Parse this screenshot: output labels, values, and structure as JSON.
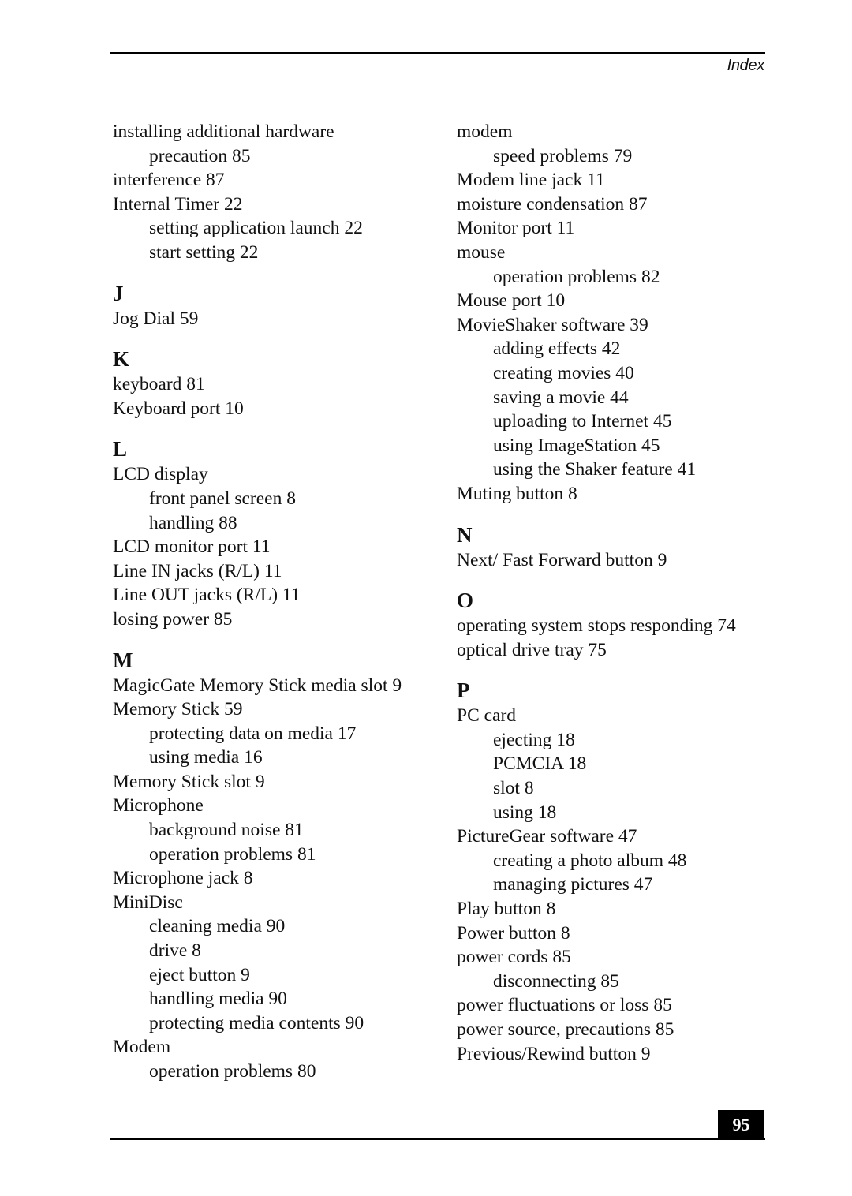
{
  "header": {
    "running_head": "Index"
  },
  "footer": {
    "page_number": "95"
  },
  "columns": [
    {
      "blocks": [
        {
          "type": "entry",
          "text": "installing additional hardware",
          "level": 0
        },
        {
          "type": "entry",
          "text": "precaution 85",
          "level": 1
        },
        {
          "type": "entry",
          "text": "interference 87",
          "level": 0
        },
        {
          "type": "entry",
          "text": "Internal Timer 22",
          "level": 0
        },
        {
          "type": "entry",
          "text": "setting application launch 22",
          "level": 1
        },
        {
          "type": "entry",
          "text": "start setting 22",
          "level": 1
        },
        {
          "type": "letter",
          "text": "J"
        },
        {
          "type": "entry",
          "text": "Jog Dial 59",
          "level": 0
        },
        {
          "type": "letter",
          "text": "K"
        },
        {
          "type": "entry",
          "text": "keyboard 81",
          "level": 0
        },
        {
          "type": "entry",
          "text": "Keyboard port 10",
          "level": 0
        },
        {
          "type": "letter",
          "text": "L"
        },
        {
          "type": "entry",
          "text": "LCD display",
          "level": 0
        },
        {
          "type": "entry",
          "text": "front panel screen 8",
          "level": 1
        },
        {
          "type": "entry",
          "text": "handling 88",
          "level": 1
        },
        {
          "type": "entry",
          "text": "LCD monitor port 11",
          "level": 0
        },
        {
          "type": "entry",
          "text": "Line IN jacks (R/L) 11",
          "level": 0
        },
        {
          "type": "entry",
          "text": "Line OUT jacks (R/L) 11",
          "level": 0
        },
        {
          "type": "entry",
          "text": "losing power 85",
          "level": 0
        },
        {
          "type": "letter",
          "text": "M"
        },
        {
          "type": "entry",
          "text": "MagicGate Memory Stick media slot 9",
          "level": 0
        },
        {
          "type": "entry",
          "text": "Memory Stick 59",
          "level": 0
        },
        {
          "type": "entry",
          "text": "protecting data on media 17",
          "level": 1
        },
        {
          "type": "entry",
          "text": "using media 16",
          "level": 1
        },
        {
          "type": "entry",
          "text": "Memory Stick slot 9",
          "level": 0
        },
        {
          "type": "entry",
          "text": "Microphone",
          "level": 0
        },
        {
          "type": "entry",
          "text": "background noise 81",
          "level": 1
        },
        {
          "type": "entry",
          "text": "operation problems 81",
          "level": 1
        },
        {
          "type": "entry",
          "text": "Microphone jack 8",
          "level": 0
        },
        {
          "type": "entry",
          "text": "MiniDisc",
          "level": 0
        },
        {
          "type": "entry",
          "text": "cleaning media 90",
          "level": 1
        },
        {
          "type": "entry",
          "text": "drive 8",
          "level": 1
        },
        {
          "type": "entry",
          "text": "eject button 9",
          "level": 1
        },
        {
          "type": "entry",
          "text": "handling media 90",
          "level": 1
        },
        {
          "type": "entry",
          "text": "protecting media contents 90",
          "level": 1
        },
        {
          "type": "entry",
          "text": "Modem",
          "level": 0
        },
        {
          "type": "entry",
          "text": "operation problems 80",
          "level": 1
        }
      ]
    },
    {
      "blocks": [
        {
          "type": "entry",
          "text": "modem",
          "level": 0
        },
        {
          "type": "entry",
          "text": "speed problems 79",
          "level": 1
        },
        {
          "type": "entry",
          "text": "Modem line jack 11",
          "level": 0
        },
        {
          "type": "entry",
          "text": "moisture condensation 87",
          "level": 0
        },
        {
          "type": "entry",
          "text": "Monitor port 11",
          "level": 0
        },
        {
          "type": "entry",
          "text": "mouse",
          "level": 0
        },
        {
          "type": "entry",
          "text": "operation problems 82",
          "level": 1
        },
        {
          "type": "entry",
          "text": "Mouse port 10",
          "level": 0
        },
        {
          "type": "entry",
          "text": "MovieShaker software 39",
          "level": 0
        },
        {
          "type": "entry",
          "text": "adding effects 42",
          "level": 1
        },
        {
          "type": "entry",
          "text": "creating movies 40",
          "level": 1
        },
        {
          "type": "entry",
          "text": "saving a movie 44",
          "level": 1
        },
        {
          "type": "entry",
          "text": "uploading to Internet 45",
          "level": 1
        },
        {
          "type": "entry",
          "text": "using ImageStation 45",
          "level": 1
        },
        {
          "type": "entry",
          "text": "using the Shaker feature 41",
          "level": 1
        },
        {
          "type": "entry",
          "text": "Muting button 8",
          "level": 0
        },
        {
          "type": "letter",
          "text": "N"
        },
        {
          "type": "entry",
          "text": "Next/ Fast Forward button 9",
          "level": 0
        },
        {
          "type": "letter",
          "text": "O"
        },
        {
          "type": "entry",
          "text": "operating system stops responding 74",
          "level": 0
        },
        {
          "type": "entry",
          "text": "optical drive tray 75",
          "level": 0
        },
        {
          "type": "letter",
          "text": "P"
        },
        {
          "type": "entry",
          "text": "PC card",
          "level": 0
        },
        {
          "type": "entry",
          "text": "ejecting 18",
          "level": 1
        },
        {
          "type": "entry",
          "text": "PCMCIA 18",
          "level": 1
        },
        {
          "type": "entry",
          "text": "slot 8",
          "level": 1
        },
        {
          "type": "entry",
          "text": "using 18",
          "level": 1
        },
        {
          "type": "entry",
          "text": "PictureGear software 47",
          "level": 0
        },
        {
          "type": "entry",
          "text": "creating a photo album 48",
          "level": 1
        },
        {
          "type": "entry",
          "text": "managing pictures 47",
          "level": 1
        },
        {
          "type": "entry",
          "text": "Play button 8",
          "level": 0
        },
        {
          "type": "entry",
          "text": "Power button 8",
          "level": 0
        },
        {
          "type": "entry",
          "text": "power cords 85",
          "level": 0
        },
        {
          "type": "entry",
          "text": "disconnecting 85",
          "level": 1
        },
        {
          "type": "entry",
          "text": "power fluctuations or loss 85",
          "level": 0
        },
        {
          "type": "entry",
          "text": "power source, precautions 85",
          "level": 0
        },
        {
          "type": "entry",
          "text": "Previous/Rewind button 9",
          "level": 0
        }
      ]
    }
  ]
}
